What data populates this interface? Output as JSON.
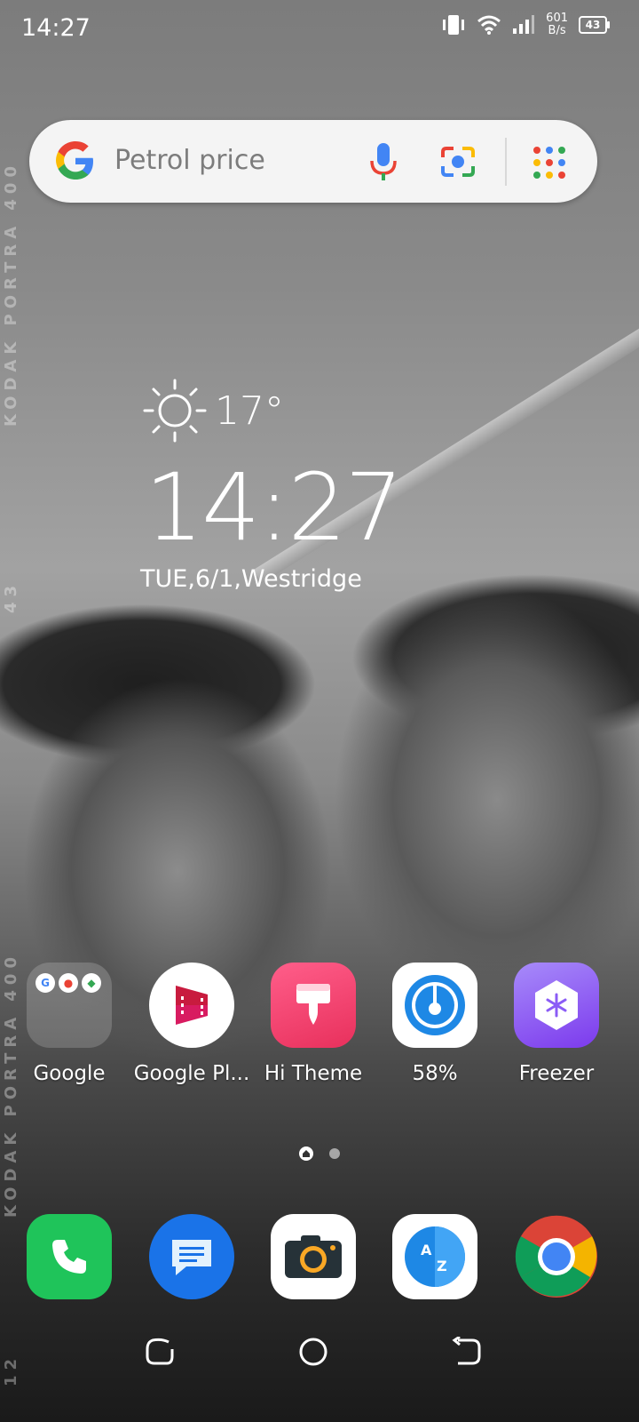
{
  "status_bar": {
    "time": "14:27",
    "net_speed_value": "601",
    "net_speed_unit": "B/s",
    "battery": "43"
  },
  "search": {
    "placeholder": "Petrol price"
  },
  "widget": {
    "temperature": "17°",
    "clock": "14:27",
    "date_location": "TUE,6/1,Westridge"
  },
  "wallpaper_text": {
    "top": "KODAK PORTRA 400",
    "mid": "43",
    "bottom": "KODAK PORTRA 400",
    "corner": "12"
  },
  "apps": [
    {
      "label": "Google",
      "icon": "google-folder-icon"
    },
    {
      "label": "Google Pl...",
      "icon": "google-play-movies-icon"
    },
    {
      "label": "Hi Theme",
      "icon": "hi-theme-icon"
    },
    {
      "label": "58%",
      "icon": "phone-manager-icon"
    },
    {
      "label": "Freezer",
      "icon": "freezer-icon"
    }
  ],
  "dock": [
    {
      "icon": "phone-icon"
    },
    {
      "icon": "messages-icon"
    },
    {
      "icon": "camera-icon"
    },
    {
      "icon": "translate-icon"
    },
    {
      "icon": "chrome-icon"
    }
  ],
  "colors": {
    "phone": "#1fc45a",
    "messages": "#1a73e8",
    "hi_theme": "#f0426a",
    "freezer": "#8b5cf6",
    "phone_manager": "#1e88e5"
  }
}
